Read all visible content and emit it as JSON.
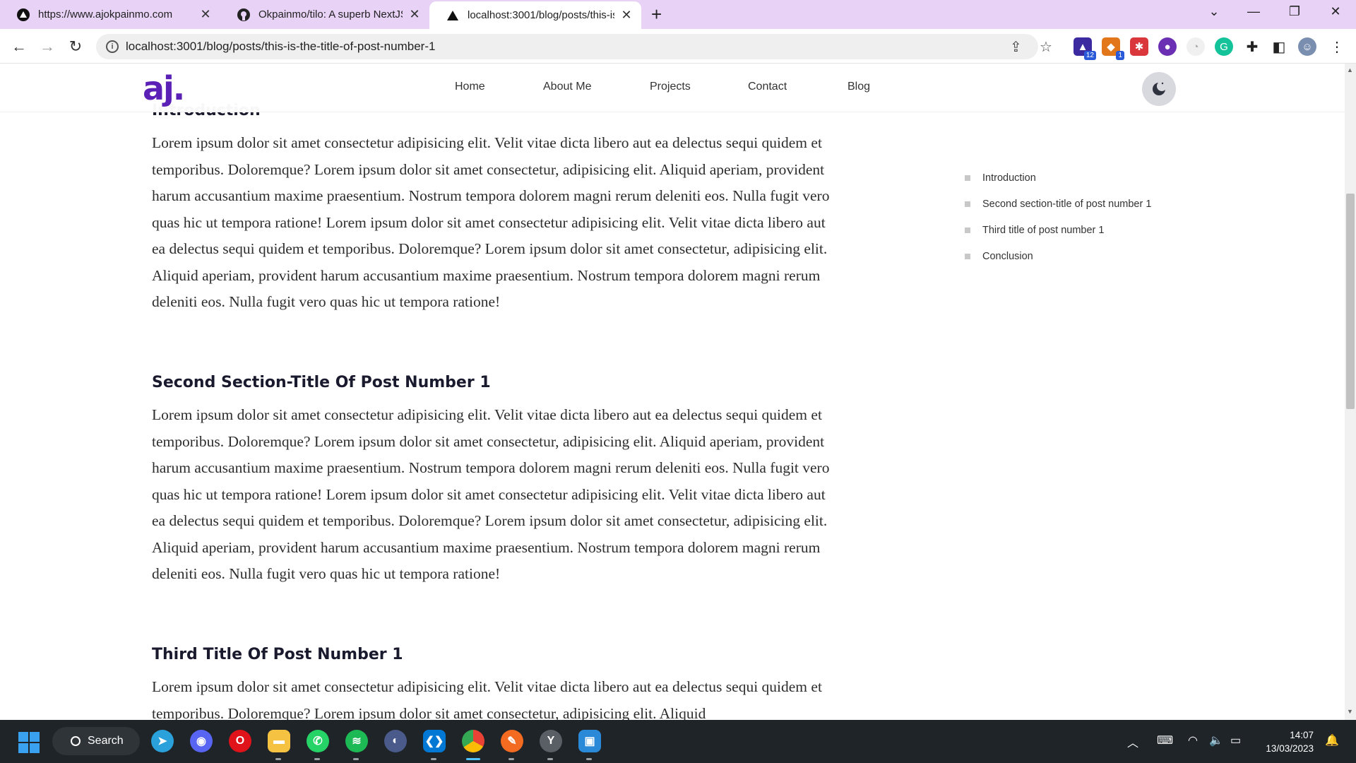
{
  "browser": {
    "tabs": [
      {
        "title": "https://www.ajokpainmo.com",
        "active": false
      },
      {
        "title": "Okpainmo/tilo: A superb NextJS",
        "active": false
      },
      {
        "title": "localhost:3001/blog/posts/this-is",
        "active": true
      }
    ],
    "url": "localhost:3001/blog/posts/this-is-the-title-of-post-number-1",
    "extension_badges": {
      "ext1": "12",
      "ext2": "1"
    }
  },
  "site": {
    "logo": "aj.",
    "nav": [
      "Home",
      "About Me",
      "Projects",
      "Contact",
      "Blog"
    ]
  },
  "article": {
    "sections": [
      {
        "heading": "Introduction",
        "body": "Lorem ipsum dolor sit amet consectetur adipisicing elit. Velit vitae dicta libero aut ea delectus sequi quidem et temporibus. Doloremque? Lorem ipsum dolor sit amet consectetur, adipisicing elit. Aliquid aperiam, provident harum accusantium maxime praesentium. Nostrum tempora dolorem magni rerum deleniti eos. Nulla fugit vero quas hic ut tempora ratione! Lorem ipsum dolor sit amet consectetur adipisicing elit. Velit vitae dicta libero aut ea delectus sequi quidem et temporibus. Doloremque? Lorem ipsum dolor sit amet consectetur, adipisicing elit. Aliquid aperiam, provident harum accusantium maxime praesentium. Nostrum tempora dolorem magni rerum deleniti eos. Nulla fugit vero quas hic ut tempora ratione!"
      },
      {
        "heading": "Second Section-Title Of Post Number 1",
        "body": "Lorem ipsum dolor sit amet consectetur adipisicing elit. Velit vitae dicta libero aut ea delectus sequi quidem et temporibus. Doloremque? Lorem ipsum dolor sit amet consectetur, adipisicing elit. Aliquid aperiam, provident harum accusantium maxime praesentium. Nostrum tempora dolorem magni rerum deleniti eos. Nulla fugit vero quas hic ut tempora ratione! Lorem ipsum dolor sit amet consectetur adipisicing elit. Velit vitae dicta libero aut ea delectus sequi quidem et temporibus. Doloremque? Lorem ipsum dolor sit amet consectetur, adipisicing elit. Aliquid aperiam, provident harum accusantium maxime praesentium. Nostrum tempora dolorem magni rerum deleniti eos. Nulla fugit vero quas hic ut tempora ratione!"
      },
      {
        "heading": "Third Title Of Post Number 1",
        "body": "Lorem ipsum dolor sit amet consectetur adipisicing elit. Velit vitae dicta libero aut ea delectus sequi quidem et temporibus. Doloremque? Lorem ipsum dolor sit amet consectetur, adipisicing elit. Aliquid"
      }
    ]
  },
  "toc": [
    "Introduction",
    "Second section-title of post number 1",
    "Third title of post number 1",
    "Conclusion"
  ],
  "taskbar": {
    "search_label": "Search",
    "time": "14:07",
    "date": "13/03/2023"
  },
  "colors": {
    "tabstrip": "#e8d3f7",
    "brand": "#5b21b6",
    "taskbar": "#1f2428"
  }
}
